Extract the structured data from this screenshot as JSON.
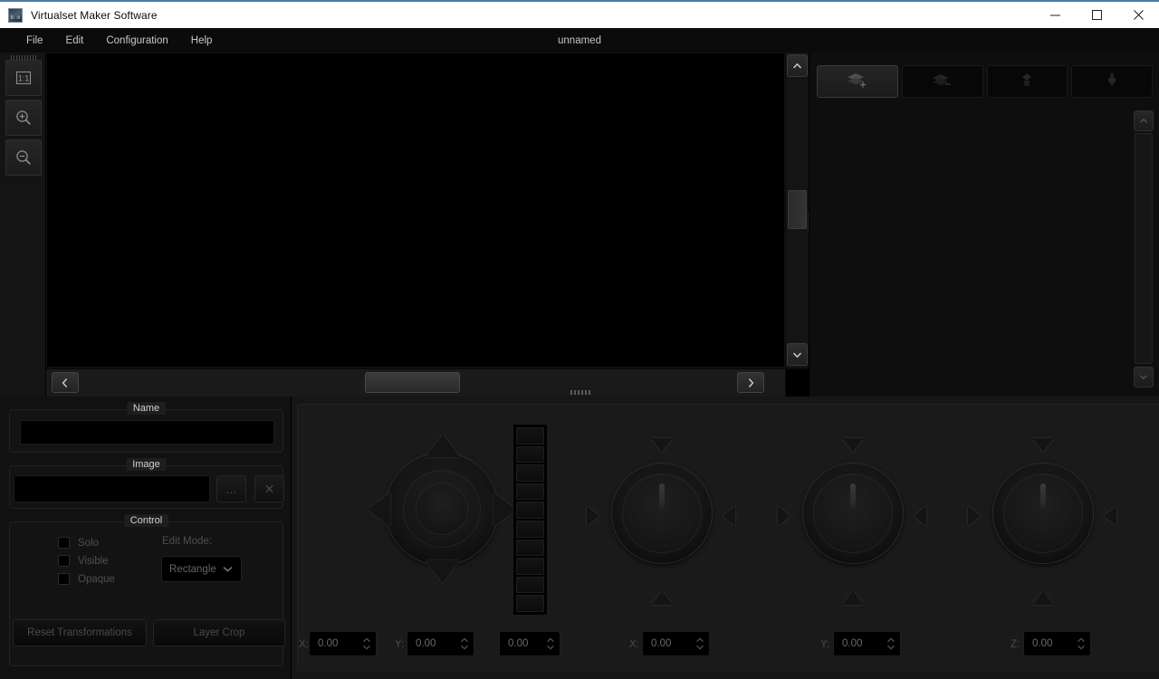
{
  "window": {
    "title": "Virtualset Maker Software",
    "icon": "app-icon",
    "minimize": "—",
    "maximize": "□",
    "close": "✕"
  },
  "menubar": {
    "items": [
      {
        "label": "File"
      },
      {
        "label": "Edit"
      },
      {
        "label": "Configuration"
      },
      {
        "label": "Help"
      }
    ]
  },
  "document": {
    "name": "unnamed"
  },
  "left_toolbar": {
    "buttons": [
      {
        "name": "zoom-actual-size-icon",
        "label": "1:1"
      },
      {
        "name": "zoom-in-icon",
        "label": "+"
      },
      {
        "name": "zoom-out-icon",
        "label": "−"
      }
    ]
  },
  "canvas": {
    "background": "#000000",
    "h_scroll": {
      "left_arrow": "‹",
      "right_arrow": "›"
    },
    "v_scroll": {
      "up_arrow": "⌃",
      "down_arrow": "⌄"
    }
  },
  "layer_panel": {
    "buttons": [
      {
        "name": "add-layer-button",
        "icon": "layers-plus-icon",
        "active": true
      },
      {
        "name": "remove-layer-button",
        "icon": "layers-minus-icon",
        "active": false
      },
      {
        "name": "move-layer-up-button",
        "icon": "layer-up-icon",
        "active": false
      },
      {
        "name": "move-layer-down-button",
        "icon": "layer-down-icon",
        "active": false
      }
    ],
    "layers": []
  },
  "properties": {
    "name_group": {
      "title": "Name",
      "value": "",
      "placeholder": ""
    },
    "image_group": {
      "title": "Image",
      "value": "",
      "placeholder": "",
      "browse_label": "...",
      "clear_label": "✕"
    },
    "control_group": {
      "title": "Control",
      "checkboxes": [
        {
          "label": "Solo",
          "checked": false
        },
        {
          "label": "Visible",
          "checked": false
        },
        {
          "label": "Opaque",
          "checked": false
        }
      ],
      "edit_mode_label": "Edit Mode:",
      "edit_mode_value": "Rectangle",
      "edit_mode_options": [
        "Rectangle"
      ],
      "reset_button": "Reset Transformations",
      "crop_button": "Layer Crop"
    }
  },
  "transform": {
    "position": {
      "x_label": "X:",
      "x_value": "0.00",
      "y_label": "Y:",
      "y_value": "0.00"
    },
    "scale": {
      "label": "",
      "value": "0.00",
      "segments": 10
    },
    "rotation_x": {
      "label": "X:",
      "value": "0.00"
    },
    "rotation_y": {
      "label": "Y:",
      "value": "0.00"
    },
    "rotation_z": {
      "label": "Z:",
      "value": "0.00"
    }
  }
}
